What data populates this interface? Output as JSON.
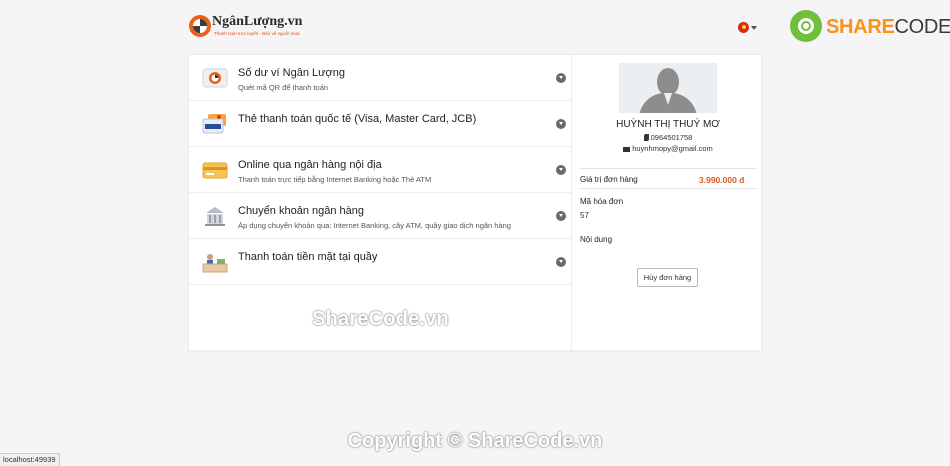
{
  "brand": {
    "name": "NgânLượng.vn",
    "tagline": "Thanh toán trực tuyến - Bảo vệ người mua"
  },
  "watermark_logo": {
    "part1": "SHARE",
    "part2": "CODE.vn"
  },
  "methods": [
    {
      "title": "Số dư ví Ngân Lượng",
      "subtitle": "Quét mã QR để thanh toán",
      "icon": "wallet-icon"
    },
    {
      "title": "Thẻ thanh toán quốc tế (Visa, Master Card, JCB)",
      "subtitle": "",
      "icon": "visa-card-icon"
    },
    {
      "title": "Online qua ngân hàng nội địa",
      "subtitle": "Thanh toán trực tiếp bằng Internet Banking hoặc Thẻ ATM",
      "icon": "atm-card-icon"
    },
    {
      "title": "Chuyển khoản ngân hàng",
      "subtitle": "Áp dụng chuyển khoản qua: Internet Banking, cây ATM, quầy giao dịch ngân hàng",
      "icon": "bank-icon"
    },
    {
      "title": "Thanh toán tiền mặt tại quầy",
      "subtitle": "",
      "icon": "cash-counter-icon"
    }
  ],
  "profile": {
    "name": "HUỲNH THỊ THUÝ MƠ",
    "phone": "0964501758",
    "email": "huynhmopy@gmail.com"
  },
  "order": {
    "total_label": "Giá trị đơn hàng",
    "total_value": "3.990.000 đ",
    "invoice_label": "Mã hóa đơn",
    "invoice_value": "57",
    "content_label": "Nội dung",
    "cancel_label": "Hủy đơn hàng"
  },
  "watermarks": {
    "middle": "ShareCode.vn",
    "bottom": "Copyright © ShareCode.vn"
  },
  "status_bar": "localhost:49939",
  "colors": {
    "accent": "#e05a1c",
    "brand_orange": "#f7921e",
    "brand_green": "#6fbf3a",
    "background": "#f5f5f7"
  }
}
